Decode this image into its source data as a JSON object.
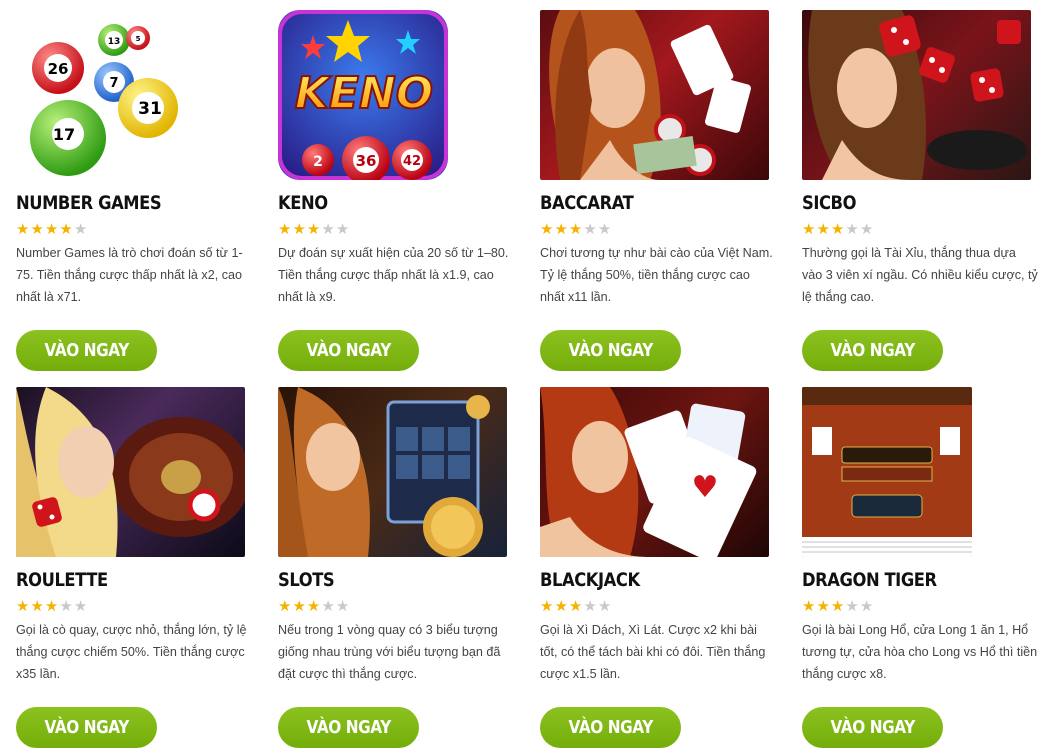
{
  "games": [
    {
      "title": "NUMBER GAMES",
      "rating": 4,
      "desc": "Number Games là trò chơi đoán số từ 1-75. Tiền thắng cược thấp nhất là x2, cao nhất là x71.",
      "button": "VÀO NGAY",
      "image": "lottery-balls-image"
    },
    {
      "title": "KENO",
      "rating": 3,
      "desc": "Dự đoán sự xuất hiện của 20 số từ 1–80. Tiền thắng cược thấp nhất là x1.9, cao nhất là x9.",
      "button": "VÀO NGAY",
      "image": "keno-logo-image",
      "logo_text": "KENO",
      "ball_numbers": [
        "2",
        "36",
        "42"
      ]
    },
    {
      "title": "BACCARAT",
      "rating": 3,
      "desc": "Chơi tương tự như bài cào của Việt Nam. Tỷ lệ thắng 50%, tiền thắng cược cao nhất x11 lần.",
      "button": "VÀO NGAY",
      "image": "baccarat-woman-image"
    },
    {
      "title": "SICBO",
      "rating": 3,
      "desc": "Thường gọi là Tài Xỉu, thắng thua dựa vào 3 viên xí ngầu. Có nhiều kiểu cược, tỷ lệ thắng cao.",
      "button": "VÀO NGAY",
      "image": "sicbo-dice-image"
    },
    {
      "title": "ROULETTE",
      "rating": 3,
      "desc": "Gọi là cò quay, cược nhỏ, thắng lớn, tỷ lệ thắng cược chiếm 50%. Tiền thắng cược x35 lần.",
      "button": "VÀO NGAY",
      "image": "roulette-woman-image"
    },
    {
      "title": "SLOTS",
      "rating": 3,
      "desc": "Nếu trong 1 vòng quay có 3 biểu tượng giống nhau trùng với biểu tượng bạn đã đặt cược thì thắng cược.",
      "button": "VÀO NGAY",
      "image": "slots-machine-image"
    },
    {
      "title": "BLACKJACK",
      "rating": 3,
      "desc": "Gọi là Xì Dách, Xì Lát. Cược x2 khi bài tốt, có thể tách bài khi có đôi. Tiền thắng cược x1.5 lần.",
      "button": "VÀO NGAY",
      "image": "blackjack-cards-image"
    },
    {
      "title": "DRAGON TIGER",
      "rating": 3,
      "desc": "Gọi là bài Long Hổ, cửa Long 1 ăn 1, Hổ tương tự, cửa hòa cho Long vs Hổ thì tiền thắng cược x8.",
      "button": "VÀO NGAY",
      "image": "dragon-tiger-table-image"
    }
  ],
  "max_rating": 5,
  "colors": {
    "button": "#7db814",
    "star_on": "#f5b301",
    "star_off": "#c9c9c9"
  }
}
